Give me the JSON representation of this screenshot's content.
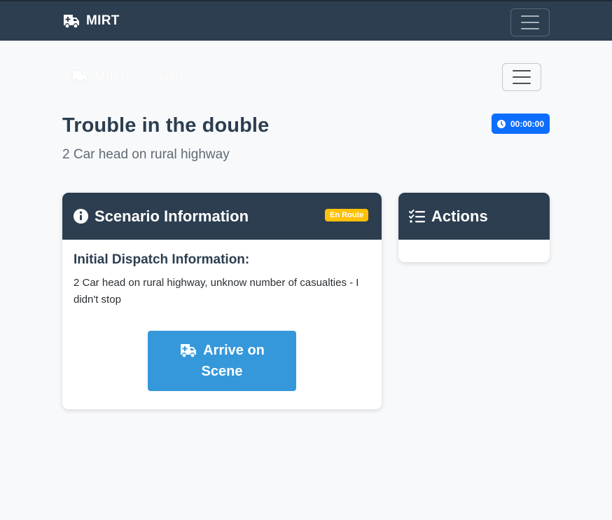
{
  "navbar": {
    "brand": "MIRT",
    "brand_icon": "ambulance-icon"
  },
  "subnav": {
    "brand": "MIRT Scenario",
    "brand_icon": "ambulance-icon"
  },
  "scenario": {
    "title": "Trouble in the double",
    "subtitle": "2 Car head on rural highway",
    "timer": "00:00:00"
  },
  "info_card": {
    "title": "Scenario Information",
    "status_badge": "En Route",
    "dispatch_heading": "Initial Dispatch Information:",
    "dispatch_text": "2 Car head on rural highway, unknow number of casualties - I didn't stop",
    "arrive_button_line1": "Arrive on",
    "arrive_button_line2": "Scene"
  },
  "actions_card": {
    "title": "Actions"
  },
  "colors": {
    "navbar": "#2c3e50",
    "badge": "#ffc107",
    "timer": "#0d6efd",
    "button": "#3498db"
  }
}
